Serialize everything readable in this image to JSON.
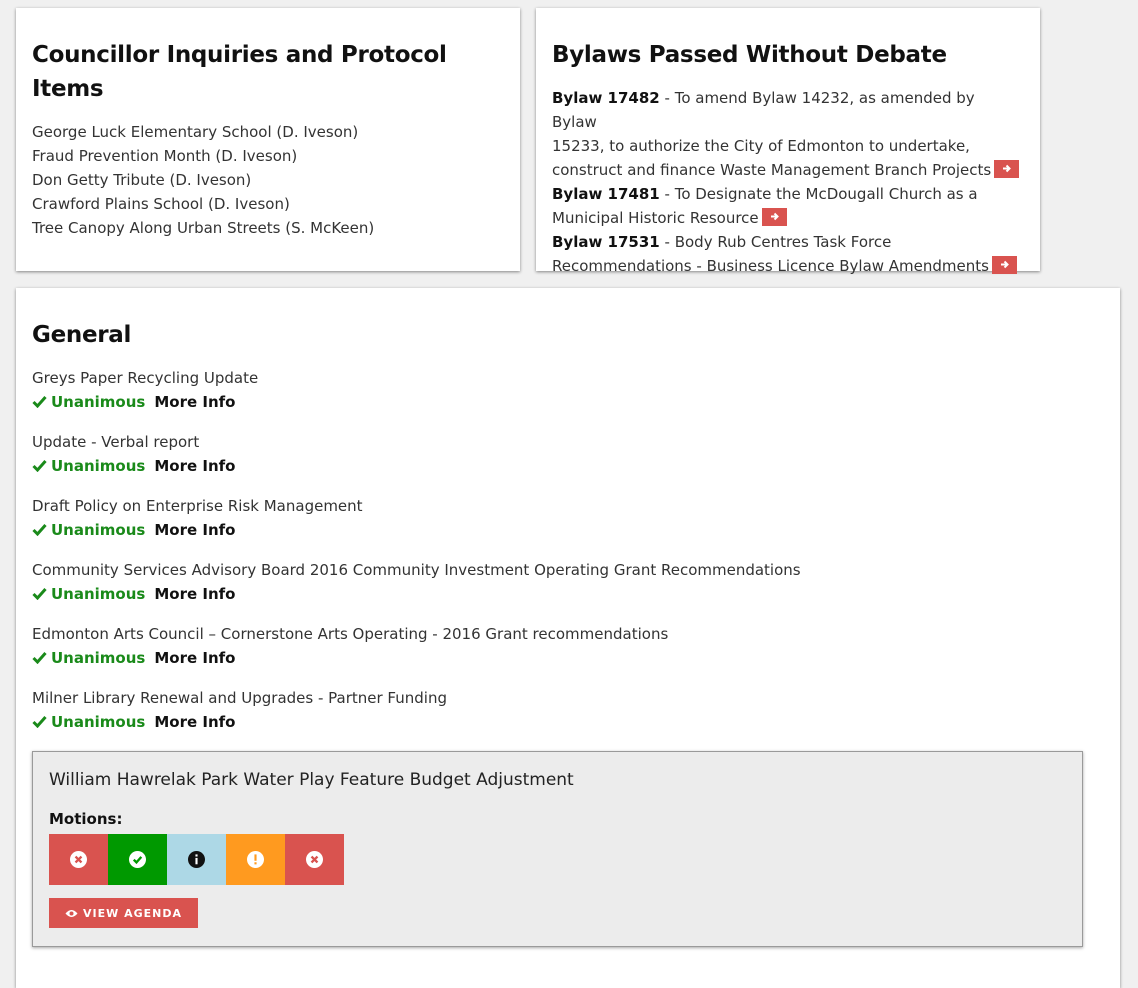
{
  "inquiries": {
    "title": "Councillor Inquiries and Protocol Items",
    "items": [
      "George Luck Elementary School (D. Iveson)",
      "Fraud Prevention Month (D. Iveson)",
      "Don Getty Tribute (D. Iveson)",
      "Crawford Plains School (D. Iveson)",
      "Tree Canopy Along Urban Streets (S. McKeen)"
    ]
  },
  "bylaws": {
    "title": "Bylaws Passed Without Debate",
    "items": [
      {
        "number": "Bylaw 17482",
        "l1": " - To amend Bylaw 14232, as amended by Bylaw",
        "l2": "15233, to authorize the City of Edmonton to undertake,",
        "l3": "construct and finance Waste Management Branch Projects"
      },
      {
        "number": "Bylaw 17481",
        "l1": " - To Designate the McDougall Church as a",
        "l2": "Municipal Historic Resource"
      },
      {
        "number": "Bylaw 17531",
        "l1": " - Body Rub Centres Task Force",
        "l2": "Recommendations - Business Licence Bylaw Amendments"
      }
    ],
    "arrow_icon": "arrow-right-icon"
  },
  "general": {
    "title": "General",
    "status_label": "Unanimous",
    "more_label": "More Info",
    "items": [
      "Greys Paper Recycling Update",
      "Update - Verbal report",
      "Draft Policy on Enterprise Risk Management",
      "Community Services Advisory Board 2016 Community Investment Operating Grant Recommendations",
      "Edmonton Arts Council – Cornerstone Arts Operating - 2016 Grant recommendations",
      "Milner Library Renewal and Upgrades - Partner Funding"
    ]
  },
  "motion": {
    "title": "William Hawrelak Park Water Play Feature Budget Adjustment",
    "label": "Motions:",
    "tiles": [
      {
        "icon": "x-circle-icon",
        "color": "#d9534f"
      },
      {
        "icon": "check-circle-icon",
        "color": "#009900"
      },
      {
        "icon": "info-circle-icon",
        "color": "#add8e6"
      },
      {
        "icon": "exclamation-circle-icon",
        "color": "#ff9a1f"
      },
      {
        "icon": "x-circle-icon",
        "color": "#d9534f"
      }
    ],
    "view_label": "VIEW AGENDA"
  },
  "colors": {
    "accent": "#d9534f",
    "success": "#1a8a1a"
  }
}
